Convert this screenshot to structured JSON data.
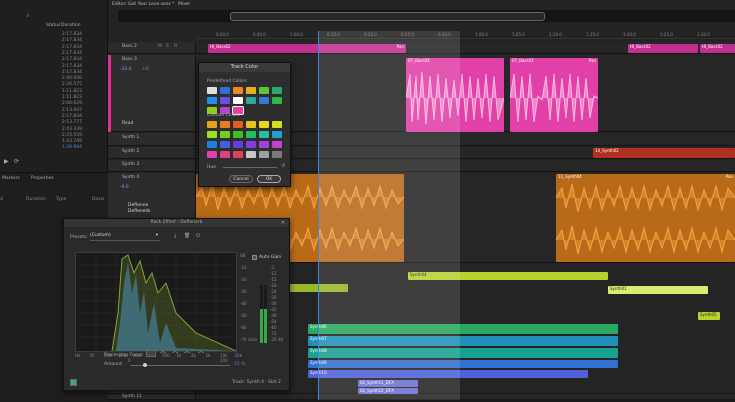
{
  "files_panel": {
    "search_icon": "search-icon",
    "columns": {
      "status": "Status",
      "duration": "Duration"
    },
    "durations": [
      "2:17.834",
      "2:17.834",
      "2:17.834",
      "2:17.834",
      "2:17.834",
      "2:17.834",
      "2:17.834",
      "2:40.000",
      "2:26.575",
      "1:11.823",
      "1:11.823",
      "2:06.629",
      "2:13.947",
      "2:17.834",
      "2:13.777",
      "2:43.339",
      "2:23.559",
      "1:43.749",
      "1:39.994"
    ]
  },
  "markers_panel": {
    "tabs": [
      "Markers",
      "Properties"
    ],
    "columns": [
      "Duration",
      "Type",
      "Descr"
    ],
    "col_first": "d"
  },
  "editor": {
    "tabs": [
      "Editor: Got Your Love.sesx *",
      "Mixer"
    ],
    "timecode": "hms",
    "ruler_ticks": [
      "0:20.0",
      "0:40.0",
      "1:00.0",
      "0:15.0",
      "0:20.0",
      "0:25.0",
      "0:30.0",
      "1:00.0",
      "1:05.0",
      "1:10.0",
      "1:15.0",
      "1:20.0",
      "1:25.0",
      "1:30.0"
    ],
    "tracks": [
      {
        "name": "Bass 2"
      },
      {
        "name": "Bass 3",
        "vol": "+0",
        "pan": "-33.6"
      },
      {
        "name": "Synth 1"
      },
      {
        "name": "Synth 2"
      },
      {
        "name": "Synth 3"
      },
      {
        "name": "Synth 4",
        "vol": "+0",
        "pan": "-9.6"
      },
      {
        "name": "Synth 11"
      }
    ],
    "bass3_sends": [
      "Read"
    ],
    "synth4_effects": [
      "Deflenne",
      "Deflenerb"
    ],
    "clips": {
      "bass2_left": "HI_Bass02",
      "bass2_mid": "Pan",
      "bass2_right": "HI_Bass02",
      "bass2_right2": "HI_Bass02",
      "bass3_a": "07_Bass03",
      "bass3_b": "07_Bass03",
      "bass3_pan": "Pan",
      "synth2": "14_Synth02",
      "synth4_a": "17_Synth04",
      "synth4_b": "11_Synth04",
      "synth4_pan": "Pan",
      "g1": "Synth04",
      "g2": "Synth02",
      "g3": "Synth01",
      "g4": "Synth05",
      "b1": "Synth06",
      "b2": "Synth07",
      "b3": "Synth08",
      "b4": "Synth09",
      "b5": "Synth10",
      "b6": "02_Synth11_DFX",
      "b7": "02_Synth12_DFX",
      "pan": "Pan"
    }
  },
  "track_color_dialog": {
    "title": "Track Color",
    "predefined_label": "Predefined Colors",
    "custom_label": "Custom Colors",
    "hue_label": "Hue",
    "predefined_colors": [
      "#e0e0e0",
      "#2f6fd6",
      "#e88a1f",
      "#e8b21f",
      "#5fc33a",
      "#2fa86b",
      "#1f8fe8",
      "#6b4fe0",
      "#ffffff",
      "#2fa8a0",
      "#3a78e0",
      "#2fb84a",
      "#8fd01f",
      "#b83fd0",
      "#e83fa0"
    ],
    "custom_colors": [
      "#e8a020",
      "#e87a20",
      "#e85a20",
      "#e8c020",
      "#e8d820",
      "#d0e020",
      "#a0e020",
      "#70d020",
      "#40c020",
      "#20c060",
      "#20c0a0",
      "#20a0d0",
      "#2080e0",
      "#4060e0",
      "#6040e0",
      "#8040e0",
      "#a040e0",
      "#c040d0",
      "#e040b0",
      "#e04080",
      "#e04060",
      "#c8c8c8",
      "#a0a0a0",
      "#7a7a7a"
    ],
    "cancel": "Cancel",
    "ok": "OK"
  },
  "rack_dialog": {
    "title": "Rack Effect - Deflenerb",
    "presets_label": "Presets:",
    "preset_value": "(Custom)",
    "auto_gain": "Auto Gain",
    "gain_label": "Gain",
    "gain_value": "-20 dB",
    "db_labels": [
      "dB",
      "-10",
      "-20",
      "-30",
      "-40",
      "-50",
      "-60",
      "-70"
    ],
    "freq_labels": [
      "Hz",
      "50",
      "100",
      "200",
      "300",
      "400",
      "500",
      "1k",
      "2k",
      "5k",
      "10k",
      "20k"
    ],
    "meter_labels": [
      "-3",
      "-12",
      "-15",
      "-18",
      "-24",
      "-30",
      "-36",
      "-42",
      "-48",
      "-54",
      "-60",
      "-72"
    ],
    "processing_focus": "Processing Focus:",
    "amount_label": "Amount:",
    "amount_min": "0",
    "amount_max": "100",
    "amount_value": "15 %",
    "track_info": "Track: Synth 4",
    "slot_info": "Slot 2"
  }
}
